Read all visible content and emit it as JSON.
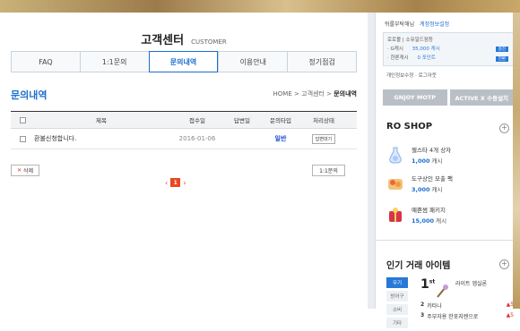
{
  "header": {
    "title": "고객센터",
    "subtitle": "CUSTOMER"
  },
  "tabs": [
    {
      "label": "FAQ"
    },
    {
      "label": "1:1문의"
    },
    {
      "label": "문의내역"
    },
    {
      "label": "이용안내"
    },
    {
      "label": "정기점검"
    }
  ],
  "section": {
    "title": "문의내역"
  },
  "breadcrumb": {
    "home": "HOME",
    "sep": ">",
    "mid": "고객센터",
    "current": "문의내역"
  },
  "table": {
    "columns": {
      "title": "제목",
      "date": "접수일",
      "answer_date": "답변일",
      "type": "문의타입",
      "status": "처리상태"
    },
    "rows": [
      {
        "title": "환불신청합니다.",
        "date": "2016-01-06",
        "answer_date": "",
        "type": "일반",
        "status": "답변대기"
      }
    ]
  },
  "buttons": {
    "delete": "삭제",
    "inquiry": "1:1문의"
  },
  "pagination": {
    "current": "1",
    "prev": "‹",
    "next": "›"
  },
  "sidebar": {
    "greeting": "뒤를부탁해님",
    "edit_link": "계정정보설정",
    "account": {
      "line1": "로로볼 | 소유일드점등",
      "gcash_label": "· G캐시",
      "gcash_value": "35,000 캐시",
      "gcash_btn": "충전",
      "point_label": "· 한론캐시",
      "point_value": "0 포인트",
      "point_btn": "전환"
    },
    "util_links": "개인정보수정 · 로그아웃",
    "btn_motp": "GNJOY MOTP",
    "btn_activex": "ACTIVE X 수동설치",
    "shop_title": "RO SHOP",
    "shop_items": [
      {
        "name": "젤스타 4개 상자",
        "price": "1,000",
        "unit": "캐시"
      },
      {
        "name": "도구상인 모출 팩",
        "price": "3,000",
        "unit": "캐시"
      },
      {
        "name": "예쁜썸 패키지",
        "price": "15,000",
        "unit": "캐시"
      }
    ],
    "hot_title": "인기 거래 아이템",
    "hot_categories": [
      "무기",
      "방어구",
      "소비",
      "기타"
    ],
    "first": {
      "rank": "1",
      "suffix": "st",
      "name": "라이트 엡실론"
    },
    "ranks": [
      {
        "n": "2",
        "name": "카타나",
        "change": "▲5"
      },
      {
        "n": "3",
        "name": "주부자용 한포지렌으로",
        "change": "▲5"
      }
    ]
  },
  "colors": {
    "accent": "#1b6fd0",
    "page_highlight": "#e8481f"
  }
}
